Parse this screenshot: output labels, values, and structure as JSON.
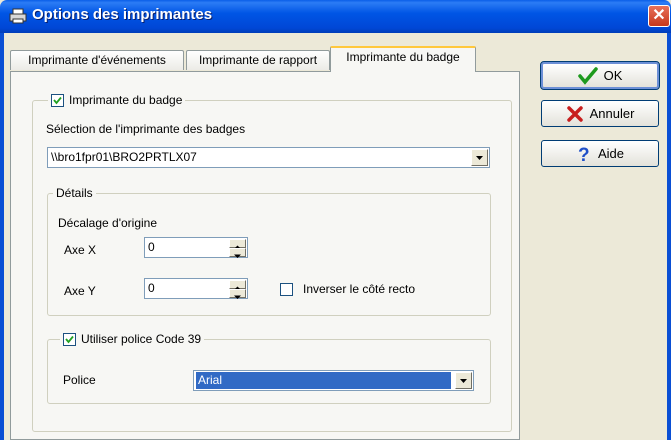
{
  "window": {
    "title": "Options des imprimantes"
  },
  "tabs": [
    {
      "label": "Imprimante d'événements"
    },
    {
      "label": "Imprimante de rapport"
    },
    {
      "label": "Imprimante du badge"
    }
  ],
  "badge_printer": {
    "group_label": "Imprimante du badge",
    "checked": true,
    "selection_label": "Sélection de l'imprimante des badges",
    "printer_value": "\\\\bro1fpr01\\BRO2PRTLX07"
  },
  "details": {
    "group_label": "Détails",
    "offset_label": "Décalage d'origine",
    "axis_x_label": "Axe X",
    "axis_x_value": "0",
    "axis_y_label": "Axe Y",
    "axis_y_value": "0",
    "invert_label": "Inverser le côté recto",
    "invert_checked": false
  },
  "font_group": {
    "group_label": "Utiliser police Code 39",
    "checked": true,
    "font_label": "Police",
    "font_value": "Arial"
  },
  "buttons": {
    "ok": "OK",
    "cancel": "Annuler",
    "help": "Aide"
  },
  "colors": {
    "titlebar": "#0055E5",
    "selection": "#316AC5",
    "tab_highlight": "#FFC83C"
  }
}
